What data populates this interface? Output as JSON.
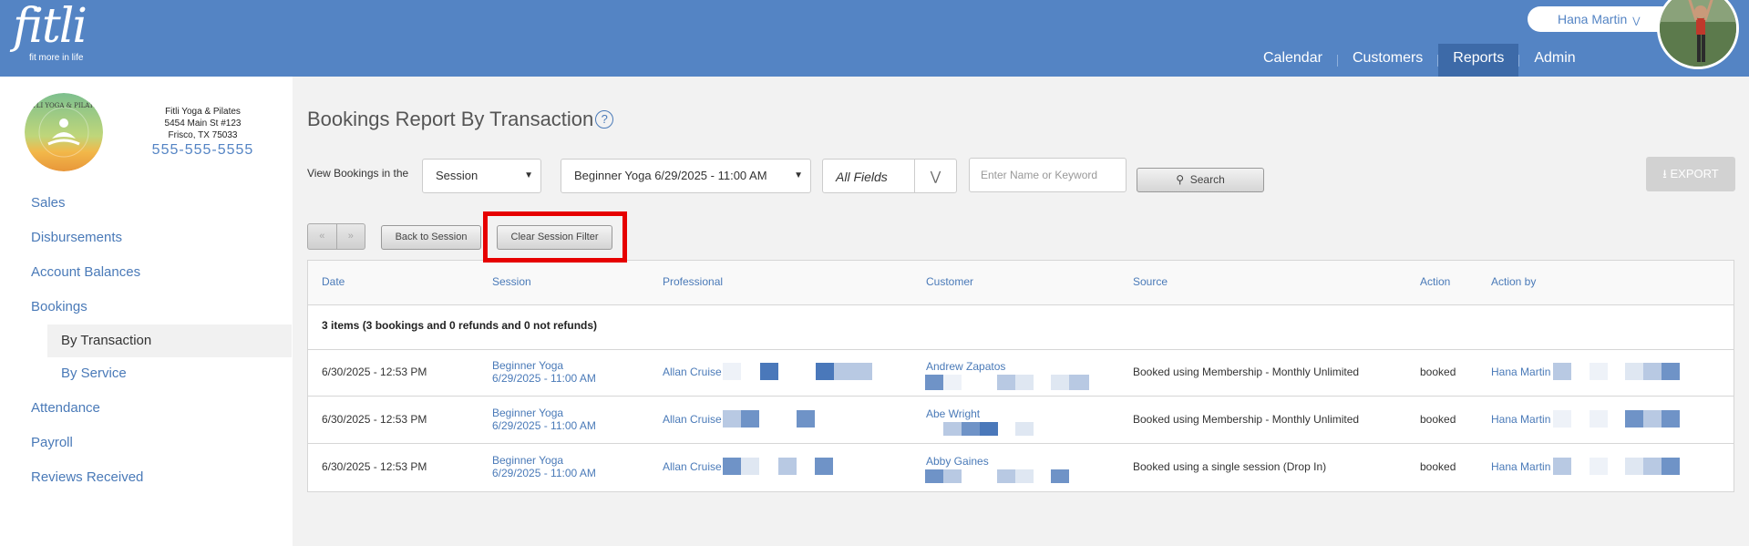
{
  "app": {
    "logo_text": "fitli",
    "logo_tagline": "fit more in life",
    "user_name": "Hana Martin",
    "nav": [
      "Calendar",
      "Customers",
      "Reports",
      "Admin"
    ]
  },
  "studio": {
    "name": "Fitli Yoga & Pilates",
    "address1": "5454 Main St #123",
    "address2": "Frisco, TX 75033",
    "phone": "555-555-5555",
    "logo_text": "FITLI YOGA & PILATES"
  },
  "sidebar": {
    "items": [
      "Sales",
      "Disbursements",
      "Account Balances",
      "Bookings",
      "Attendance",
      "Payroll",
      "Reviews Received"
    ],
    "sub_items": [
      "By Transaction",
      "By Service"
    ]
  },
  "page": {
    "title": "Bookings Report By Transaction",
    "help_glyph": "?",
    "view_label": "View Bookings in the",
    "view_select": "Session",
    "session_select": "Beginner Yoga 6/29/2025 - 11:00 AM",
    "fields_select": "All Fields",
    "search_placeholder": "Enter Name or Keyword",
    "search_button": "Search",
    "export_button": "EXPORT",
    "prev_glyph": "«",
    "next_glyph": "»",
    "back_button": "Back to Session",
    "clear_button": "Clear Session Filter"
  },
  "table": {
    "columns": [
      "Date",
      "Session",
      "Professional",
      "Customer",
      "Source",
      "Action",
      "Action by"
    ],
    "summary": "3 items (3 bookings and 0 refunds and 0 not refunds)",
    "rows": [
      {
        "date": "6/30/2025 - 12:53 PM",
        "session_name": "Beginner Yoga",
        "session_time": "6/29/2025 - 11:00 AM",
        "professional": "Allan Cruise",
        "customer": "Andrew Zapatos",
        "source": "Booked using Membership - Monthly Unlimited",
        "action": "booked",
        "action_by": "Hana Martin"
      },
      {
        "date": "6/30/2025 - 12:53 PM",
        "session_name": "Beginner Yoga",
        "session_time": "6/29/2025 - 11:00 AM",
        "professional": "Allan Cruise",
        "customer": "Abe Wright",
        "source": "Booked using Membership - Monthly Unlimited",
        "action": "booked",
        "action_by": "Hana Martin"
      },
      {
        "date": "6/30/2025 - 12:53 PM",
        "session_name": "Beginner Yoga",
        "session_time": "6/29/2025 - 11:00 AM",
        "professional": "Allan Cruise",
        "customer": "Abby Gaines",
        "source": "Booked using a single session (Drop In)",
        "action": "booked",
        "action_by": "Hana Martin"
      }
    ]
  },
  "colors": {
    "header": "#5484c4",
    "link": "#4a7ab8",
    "highlight": "#e60000"
  }
}
